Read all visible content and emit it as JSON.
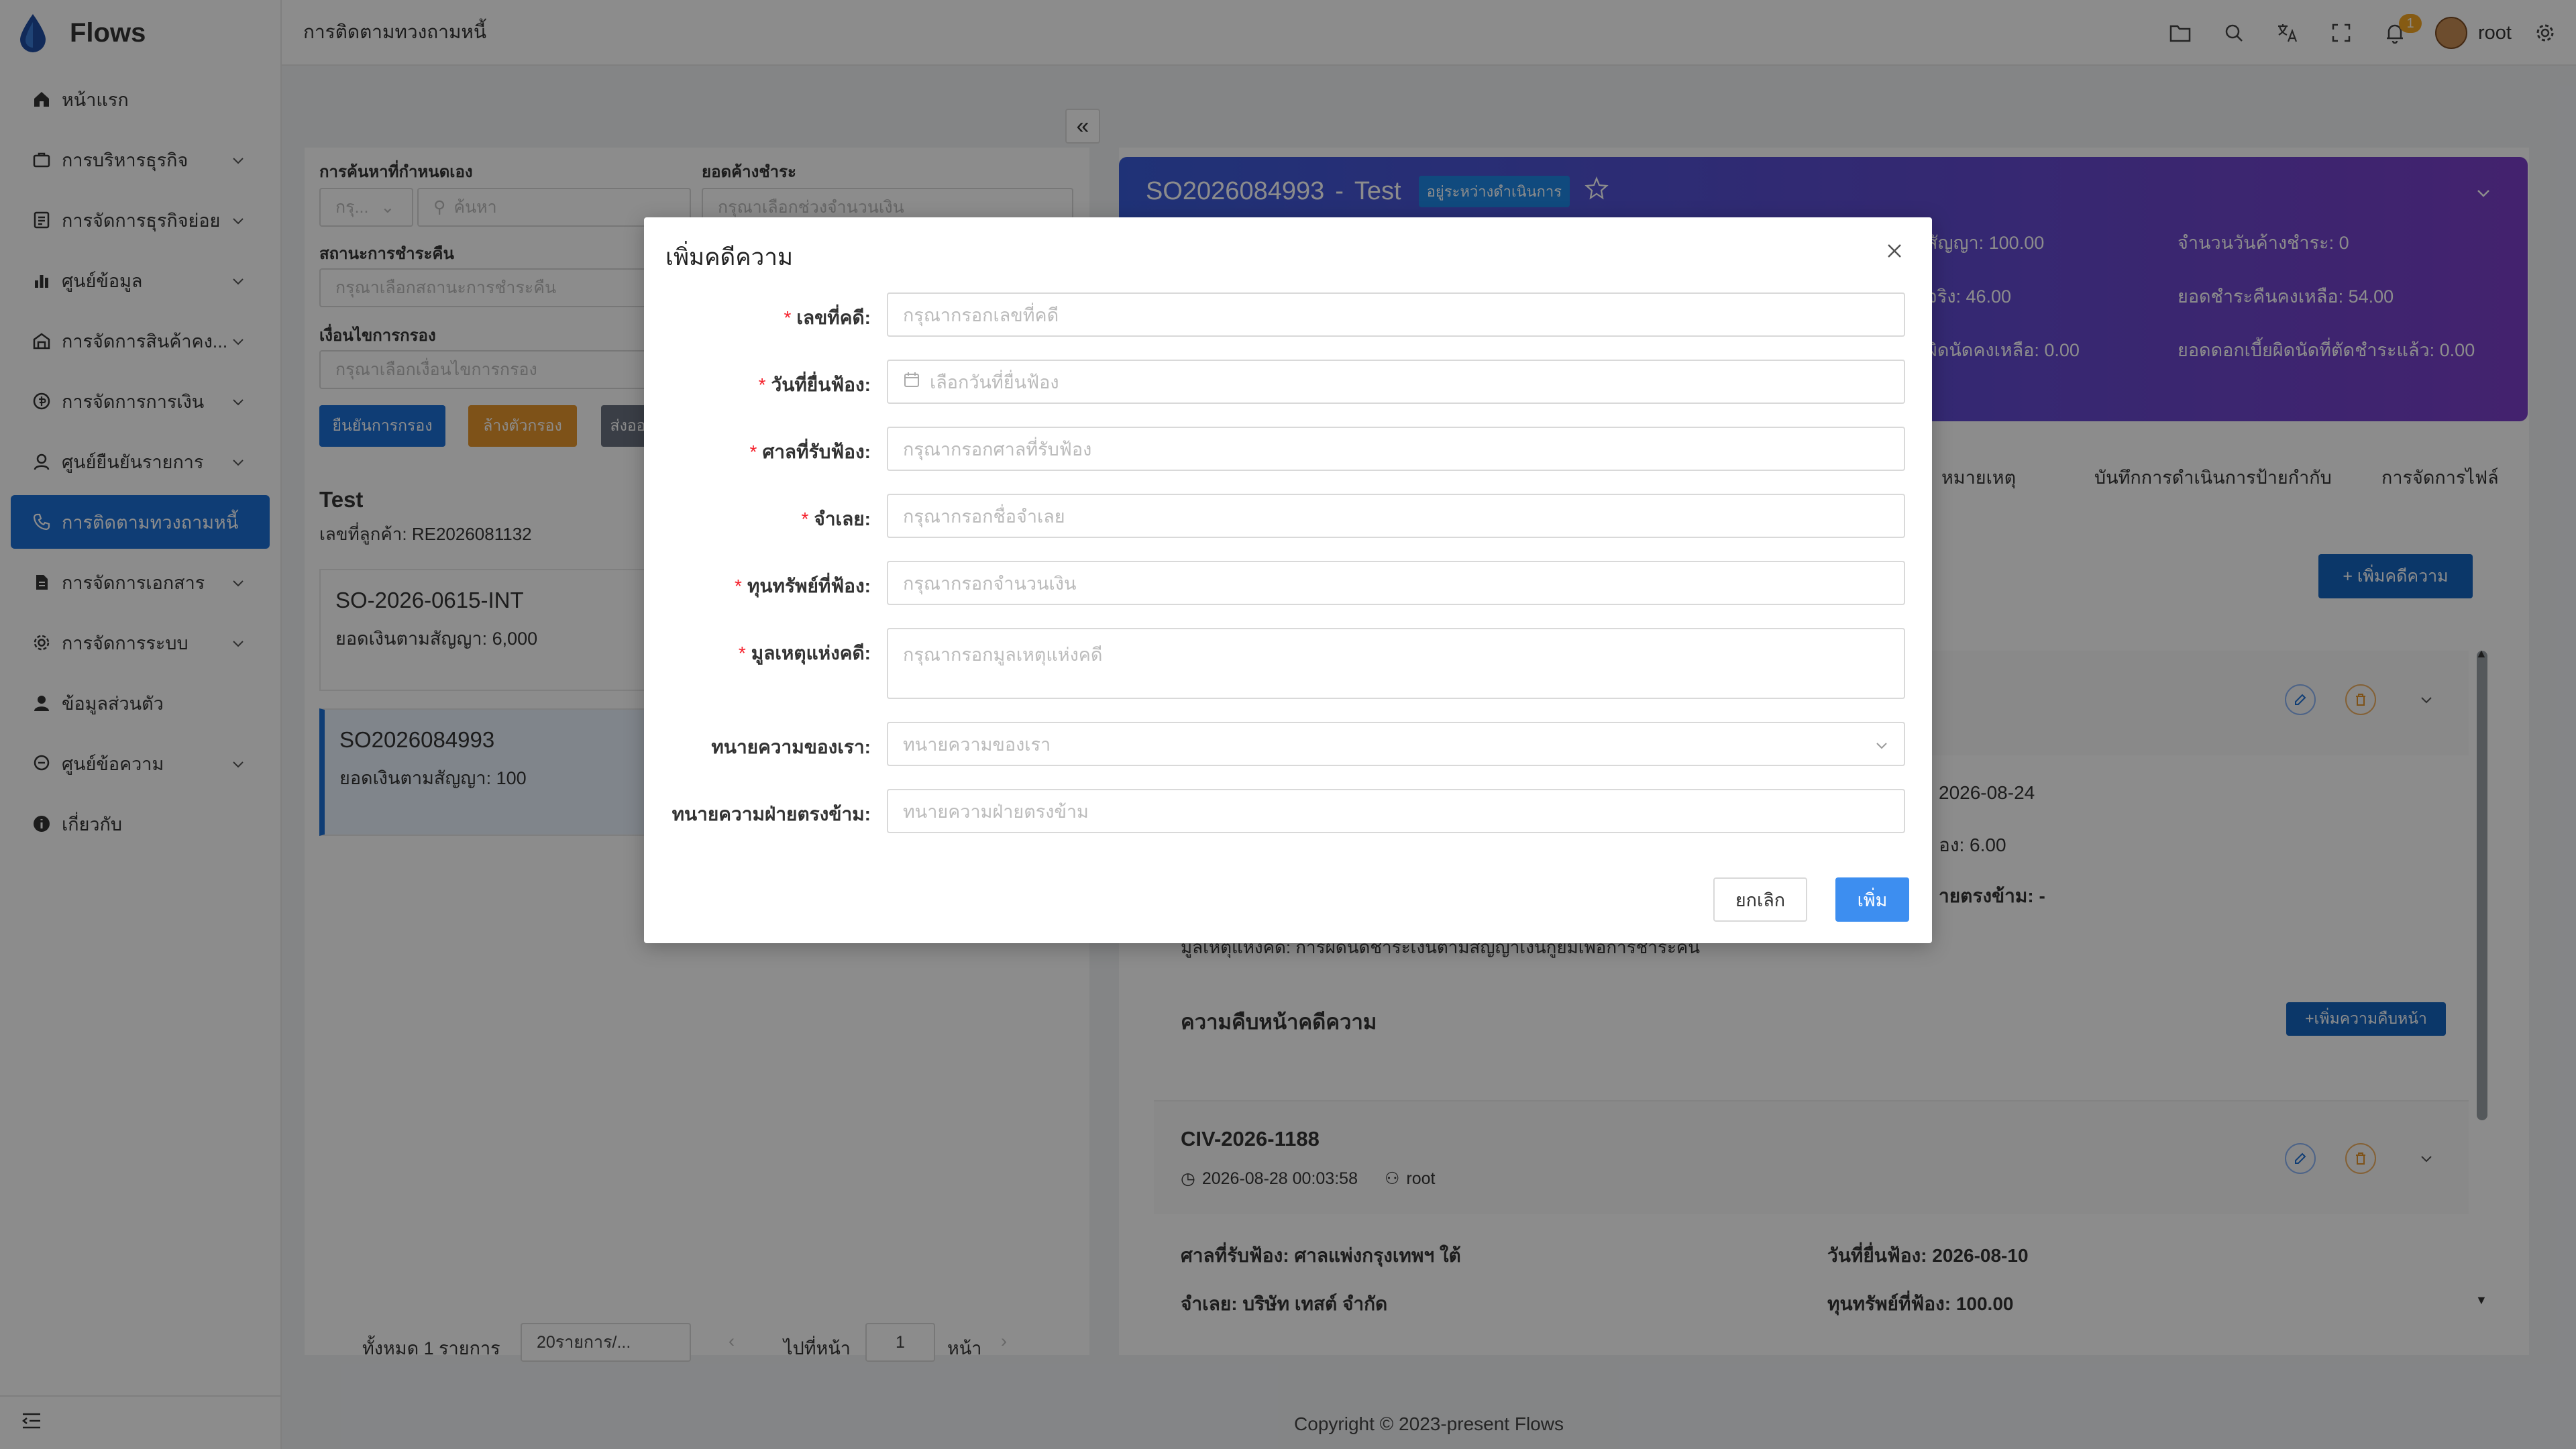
{
  "app": {
    "name": "Flows"
  },
  "sidebar": {
    "items": [
      {
        "label": "หน้าแรก",
        "icon": "home-icon"
      },
      {
        "label": "การบริหารธุรกิจ",
        "icon": "briefcase-icon"
      },
      {
        "label": "การจัดการธุรกิจย่อย",
        "icon": "document-list-icon"
      },
      {
        "label": "ศูนย์ข้อมูล",
        "icon": "bar-chart-icon"
      },
      {
        "label": "การจัดการสินค้าคง...",
        "icon": "warehouse-icon"
      },
      {
        "label": "การจัดการการเงิน",
        "icon": "money-icon"
      },
      {
        "label": "ศูนย์ยืนยันรายการ",
        "icon": "user-check-icon"
      },
      {
        "label": "การติดตามทวงถามหนี้",
        "icon": "phone-icon"
      },
      {
        "label": "การจัดการเอกสาร",
        "icon": "file-icon"
      },
      {
        "label": "การจัดการระบบ",
        "icon": "gear-icon"
      },
      {
        "label": "ข้อมูลส่วนตัว",
        "icon": "person-icon"
      },
      {
        "label": "ศูนย์ข้อความ",
        "icon": "message-icon"
      },
      {
        "label": "เกี่ยวกับ",
        "icon": "info-icon"
      }
    ]
  },
  "header": {
    "page_title": "การติดตามทวงถามหนี้",
    "notification_count": "1",
    "user_name": "root"
  },
  "filters": {
    "custom_search_label": "การค้นหาที่กำหนดเอง",
    "custom_search_select": "กรุ...",
    "search_placeholder": "ค้นหา",
    "outstanding_label": "ยอดค้างชำระ",
    "outstanding_placeholder": "กรุณาเลือกช่วงจำนวนเงิน",
    "payment_status_label": "สถานะการชำระคืน",
    "payment_status_placeholder": "กรุณาเลือกสถานะการชำระคืน",
    "condition_label": "เงื่อนไขการกรอง",
    "condition_placeholder": "กรุณาเลือกเงื่อนไขการกรอง",
    "confirm_button": "ยืนยันการกรอง",
    "clear_button": "ล้างตัวกรอง",
    "export_button": "ส่งออ"
  },
  "customer": {
    "name": "Test",
    "code": "เลขที่ลูกค้า: RE2026081132"
  },
  "orders": [
    {
      "title": "SO-2026-0615-INT",
      "sub": "ยอดเงินตามสัญญา: 6,000"
    },
    {
      "title": "SO2026084993",
      "sub": "ยอดเงินตามสัญญา: 100"
    }
  ],
  "pagination": {
    "total": "ทั้งหมด 1 รายการ",
    "page_size": "20รายการ/...",
    "goto": "ไปที่หน้า",
    "page": "1",
    "page_suffix": "หน้า"
  },
  "hero": {
    "order_id": "SO2026084993",
    "separator": "-",
    "name": "Test",
    "status": "อยู่ระหว่างดำเนินการ",
    "stat1": "สัญญา: 100.00",
    "stat2": "จำนวนวันค้างชำระ: 0",
    "stat3": "จริง: 46.00",
    "stat4": "ยอดชำระคืนคงเหลือ: 54.00",
    "stat5": "ผิดนัดคงเหลือ: 0.00",
    "stat6": "ยอดดอกเบี้ยผิดนัดที่ตัดชำระแล้ว: 0.00"
  },
  "tabs": [
    "หมายเหตุ",
    "บันทึกการดำเนินการป้ายกำกับ",
    "การจัดการไฟล์"
  ],
  "cases": {
    "add_case_button": "+ เพิ่มคดีความ",
    "date_frag": "2026-08-24",
    "fee_frag": "อง: 6.00",
    "opp_frag": "ายตรงข้าม: -",
    "cause_frag": "มูลเหตุแห่งคดี: การผิดนัดชำระเงินตามสัญญาเงินกู้ยืมเพื่อการชำระคืน",
    "progress_title": "ความคืบหน้าคดีความ",
    "add_progress_button": "+เพิ่มความคืบหน้า",
    "case2_no": "CIV-2026-1188",
    "case2_time": "2026-08-28 00:03:58",
    "case2_user": "root",
    "case2_court": "ศาลที่รับฟ้อง: ศาลแพ่งกรุงเทพฯ ใต้",
    "case2_filed": "วันที่ยื่นฟ้อง: 2026-08-10",
    "case2_defendant": "จำเลย: บริษัท เทสต์ จำกัด",
    "case2_amount": "ทุนทรัพย์ที่ฟ้อง: 100.00"
  },
  "footer": {
    "copyright": "Copyright © 2023-present Flows"
  },
  "modal": {
    "title": "เพิ่มคดีความ",
    "fields": [
      {
        "label": "เลขที่คดี:",
        "placeholder": "กรุณากรอกเลขที่คดี",
        "required": true
      },
      {
        "label": "วันที่ยื่นฟ้อง:",
        "placeholder": "เลือกวันที่ยื่นฟ้อง",
        "required": true
      },
      {
        "label": "ศาลที่รับฟ้อง:",
        "placeholder": "กรุณากรอกศาลที่รับฟ้อง",
        "required": true
      },
      {
        "label": "จำเลย:",
        "placeholder": "กรุณากรอกชื่อจำเลย",
        "required": true
      },
      {
        "label": "ทุนทรัพย์ที่ฟ้อง:",
        "placeholder": "กรุณากรอกจำนวนเงิน",
        "required": true
      },
      {
        "label": "มูลเหตุแห่งคดี:",
        "placeholder": "กรุณากรอกมูลเหตุแห่งคดี",
        "required": true
      },
      {
        "label": "ทนายความของเรา:",
        "placeholder": "ทนายความของเรา",
        "required": false
      },
      {
        "label": "ทนายความฝ่ายตรงข้าม:",
        "placeholder": "ทนายความฝ่ายตรงข้าม",
        "required": false
      }
    ],
    "required_mark": "*",
    "cancel_button": "ยกเลิก",
    "submit_button": "เพิ่ม"
  },
  "colors": {
    "primary": "#1d6fd6",
    "button_blue": "#3d8ef0",
    "warning": "#e6952d",
    "hero_start": "#3a5bd9",
    "hero_end": "#7b3fc9"
  }
}
